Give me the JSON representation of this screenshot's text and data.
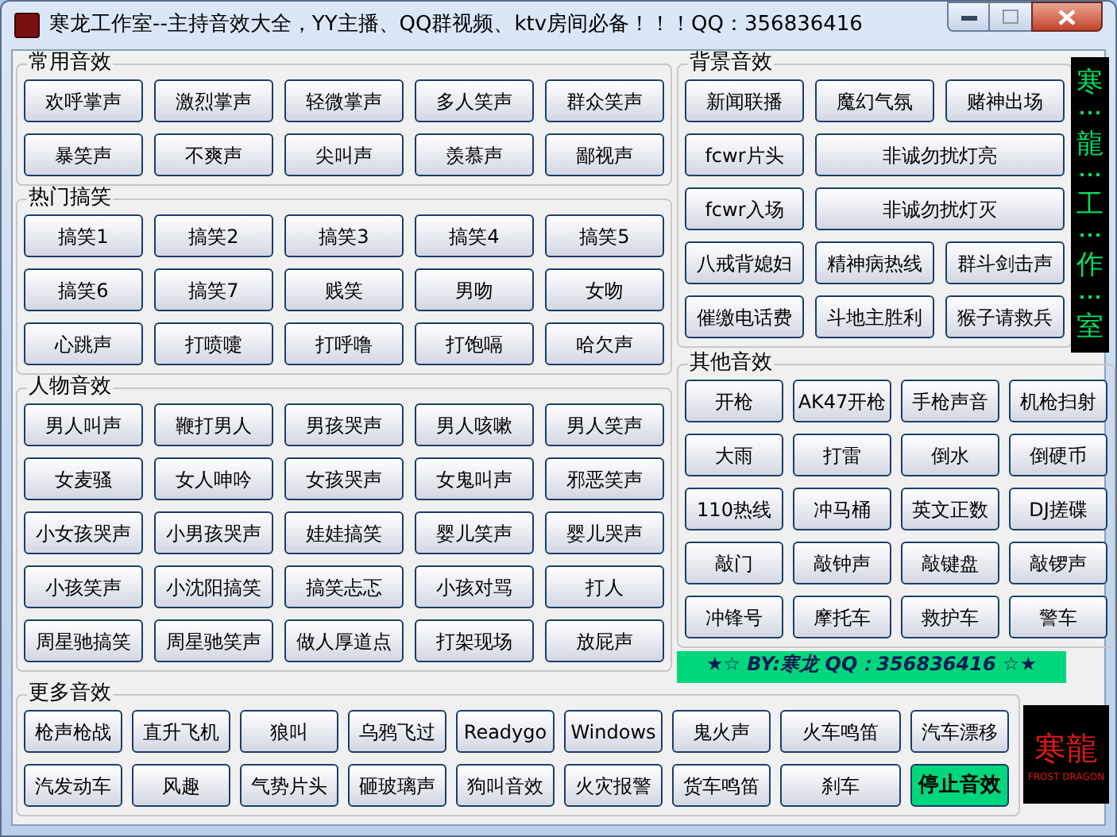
{
  "window": {
    "title": "寒龙工作室--主持音效大全，YY主播、QQ群视频、ktv房间必备！！！QQ：356836416"
  },
  "left_groups": [
    {
      "title": "常用音效",
      "buttons": [
        {
          "label": "欢呼掌声"
        },
        {
          "label": "激烈掌声"
        },
        {
          "label": "轻微掌声"
        },
        {
          "label": "多人笑声"
        },
        {
          "label": "群众笑声"
        },
        {
          "label": "暴笑声"
        },
        {
          "label": "不爽声"
        },
        {
          "label": "尖叫声"
        },
        {
          "label": "羡慕声"
        },
        {
          "label": "鄙视声"
        }
      ]
    },
    {
      "title": "热门搞笑",
      "buttons": [
        {
          "label": "搞笑1"
        },
        {
          "label": "搞笑2"
        },
        {
          "label": "搞笑3"
        },
        {
          "label": "搞笑4"
        },
        {
          "label": "搞笑5"
        },
        {
          "label": "搞笑6"
        },
        {
          "label": "搞笑7"
        },
        {
          "label": "贱笑"
        },
        {
          "label": "男吻"
        },
        {
          "label": "女吻"
        },
        {
          "label": "心跳声"
        },
        {
          "label": "打喷嚏"
        },
        {
          "label": "打呼噜"
        },
        {
          "label": "打饱嗝"
        },
        {
          "label": "哈欠声"
        }
      ]
    },
    {
      "title": "人物音效",
      "buttons": [
        {
          "label": "男人叫声"
        },
        {
          "label": "鞭打男人"
        },
        {
          "label": "男孩哭声"
        },
        {
          "label": "男人咳嗽"
        },
        {
          "label": "男人笑声"
        },
        {
          "label": "女麦骚"
        },
        {
          "label": "女人呻吟"
        },
        {
          "label": "女孩哭声"
        },
        {
          "label": "女鬼叫声"
        },
        {
          "label": "邪恶笑声"
        },
        {
          "label": "小女孩哭声"
        },
        {
          "label": "小男孩哭声"
        },
        {
          "label": "娃娃搞笑"
        },
        {
          "label": "婴儿笑声"
        },
        {
          "label": "婴儿哭声"
        },
        {
          "label": "小孩笑声"
        },
        {
          "label": "小沈阳搞笑"
        },
        {
          "label": "搞笑忐忑"
        },
        {
          "label": "小孩对骂"
        },
        {
          "label": "打人"
        },
        {
          "label": "周星驰搞笑"
        },
        {
          "label": "周星驰笑声"
        },
        {
          "label": "做人厚道点"
        },
        {
          "label": "打架现场"
        },
        {
          "label": "放屁声"
        }
      ]
    }
  ],
  "background_group": {
    "title": "背景音效",
    "buttons": [
      {
        "label": "新闻联播",
        "kind": "normal"
      },
      {
        "label": "魔幻气氛",
        "kind": "normal"
      },
      {
        "label": "赌神出场",
        "kind": "normal"
      },
      {
        "label": "fcwr片头",
        "kind": "normal"
      },
      {
        "label": "非诚勿扰灯亮",
        "kind": "wide"
      },
      {
        "label": "fcwr入场",
        "kind": "normal"
      },
      {
        "label": "非诚勿扰灯灭",
        "kind": "wide"
      },
      {
        "label": "八戒背媳妇",
        "kind": "normal"
      },
      {
        "label": "精神病热线",
        "kind": "normal"
      },
      {
        "label": "群斗剑击声",
        "kind": "normal"
      },
      {
        "label": "催缴电话费",
        "kind": "normal"
      },
      {
        "label": "斗地主胜利",
        "kind": "normal"
      },
      {
        "label": "猴子请救兵",
        "kind": "normal"
      }
    ]
  },
  "side_banner": {
    "characters": [
      "寒",
      "龍",
      "工",
      "作",
      "室"
    ]
  },
  "other_group": {
    "title": "其他音效",
    "buttons": [
      {
        "label": "开枪"
      },
      {
        "label": "AK47开枪"
      },
      {
        "label": "手枪声音"
      },
      {
        "label": "机枪扫射"
      },
      {
        "label": "大雨"
      },
      {
        "label": "打雷"
      },
      {
        "label": "倒水"
      },
      {
        "label": "倒硬币"
      },
      {
        "label": "110热线"
      },
      {
        "label": "冲马桶"
      },
      {
        "label": "英文正数"
      },
      {
        "label": "DJ搓碟"
      },
      {
        "label": "敲门"
      },
      {
        "label": "敲钟声"
      },
      {
        "label": "敲键盘"
      },
      {
        "label": "敲锣声"
      },
      {
        "label": "冲锋号"
      },
      {
        "label": "摩托车"
      },
      {
        "label": "救护车"
      },
      {
        "label": "警车"
      }
    ]
  },
  "marquee": {
    "text": "★☆ BY:寒龙   QQ：356836416 ☆★"
  },
  "more_group": {
    "title": "更多音效",
    "buttons": [
      {
        "label": "枪声枪战",
        "kind": "normal"
      },
      {
        "label": "直升飞机",
        "kind": "normal"
      },
      {
        "label": "狼叫",
        "kind": "normal"
      },
      {
        "label": "乌鸦飞过",
        "kind": "normal"
      },
      {
        "label": "Readygo",
        "kind": "normal"
      },
      {
        "label": "Windows",
        "kind": "normal"
      },
      {
        "label": "鬼火声",
        "kind": "normal"
      },
      {
        "label": "火车鸣笛",
        "kind": "normal"
      },
      {
        "label": "汽车漂移",
        "kind": "normal"
      },
      {
        "label": "汽发动车",
        "kind": "normal"
      },
      {
        "label": "风趣",
        "kind": "normal"
      },
      {
        "label": "气势片头",
        "kind": "normal"
      },
      {
        "label": "砸玻璃声",
        "kind": "normal"
      },
      {
        "label": "狗叫音效",
        "kind": "normal"
      },
      {
        "label": "火灾报警",
        "kind": "normal"
      },
      {
        "label": "货车鸣笛",
        "kind": "normal"
      },
      {
        "label": "刹车",
        "kind": "normal"
      },
      {
        "label": "停止音效",
        "kind": "stop"
      }
    ]
  },
  "logo": {
    "text": "寒龍",
    "subtitle": "FROST DRAGON"
  }
}
